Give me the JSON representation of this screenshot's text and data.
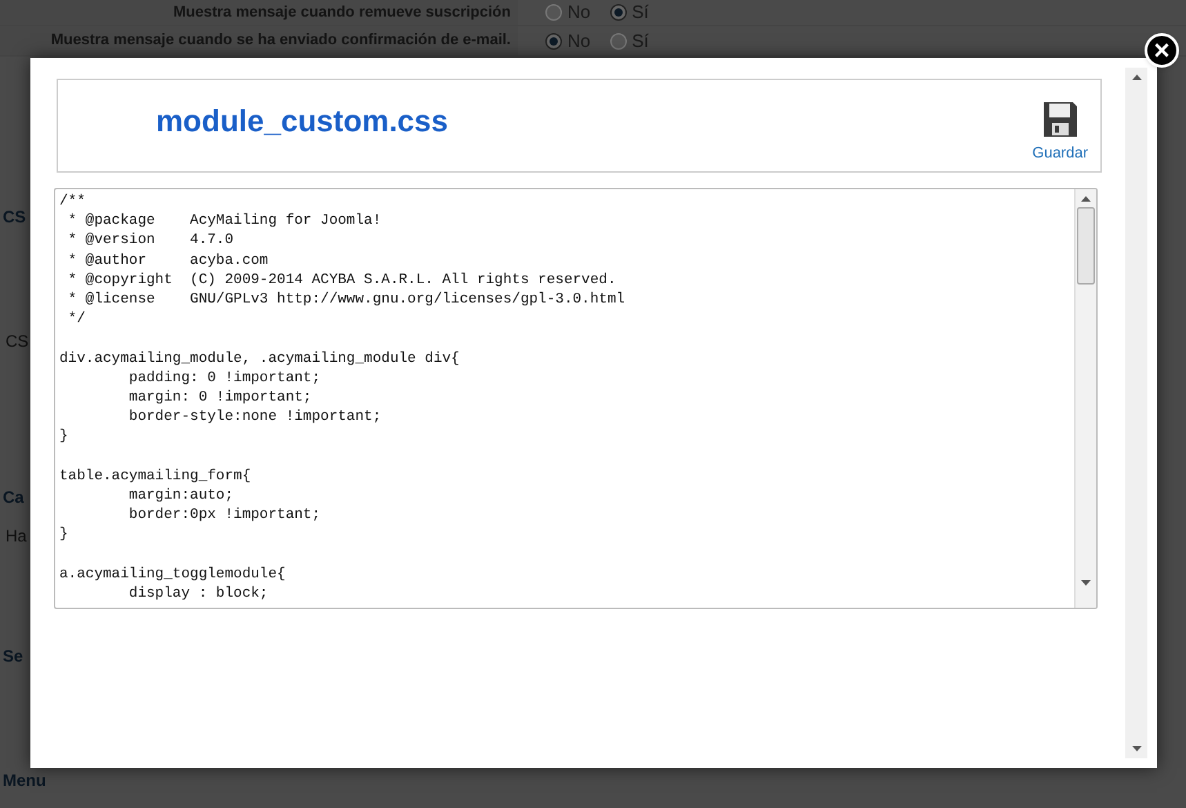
{
  "background_page": {
    "settings": [
      {
        "label": "Muestra mensaje cuando remueve suscripción",
        "options": [
          {
            "label": "No",
            "selected": false
          },
          {
            "label": "Sí",
            "selected": true
          }
        ]
      },
      {
        "label": "Muestra mensaje cuando se ha enviado confirmación de e-mail.",
        "options": [
          {
            "label": "No",
            "selected": true
          },
          {
            "label": "Sí",
            "selected": false
          }
        ]
      }
    ],
    "section_fragments": [
      {
        "kind": "heading",
        "text": "CS"
      },
      {
        "kind": "label",
        "text": "CS"
      },
      {
        "kind": "heading",
        "text": "Ca"
      },
      {
        "kind": "label",
        "text": "Ha"
      },
      {
        "kind": "heading",
        "text": "Se"
      },
      {
        "kind": "heading",
        "text": "Menu"
      }
    ]
  },
  "modal": {
    "title": "module_custom.css",
    "save_button": "Guardar",
    "close_button": "×",
    "code_blocks": [
      [
        "/**",
        " * @package    AcyMailing for Joomla!",
        " * @version    4.7.0",
        " * @author     acyba.com",
        " * @copyright  (C) 2009-2014 ACYBA S.A.R.L. All rights reserved.",
        " * @license    GNU/GPLv3 http://www.gnu.org/licenses/gpl-3.0.html",
        " */"
      ],
      [
        "div.acymailing_module, .acymailing_module div{",
        "        padding: 0 !important;",
        "        margin: 0 !important;",
        "        border-style:none !important;",
        "}"
      ],
      [
        "table.acymailing_form{",
        "        margin:auto;",
        "        border:0px !important;",
        "}"
      ],
      [
        "a.acymailing_togglemodule{",
        "        display : block;"
      ]
    ]
  }
}
